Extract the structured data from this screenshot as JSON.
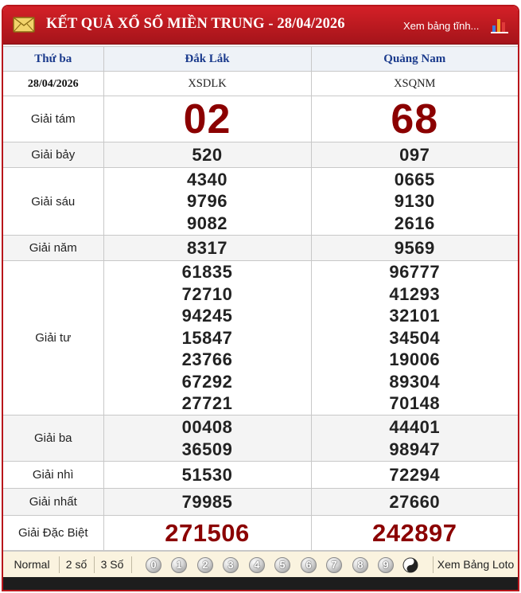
{
  "header": {
    "title": "KẾT QUẢ XỔ SỐ MIỀN TRUNG - 28/04/2026",
    "link_label": "Xem bảng tĩnh..."
  },
  "table": {
    "day": "Thứ ba",
    "date": "28/04/2026",
    "provinces": [
      {
        "name": "Đắk Lắk",
        "code": "XSDLK"
      },
      {
        "name": "Quảng Nam",
        "code": "XSQNM"
      }
    ],
    "prizes": [
      {
        "label": "Giải tám",
        "values": [
          [
            "02"
          ],
          [
            "68"
          ]
        ]
      },
      {
        "label": "Giải bảy",
        "values": [
          [
            "520"
          ],
          [
            "097"
          ]
        ]
      },
      {
        "label": "Giải sáu",
        "values": [
          [
            "4340",
            "9796",
            "9082"
          ],
          [
            "0665",
            "9130",
            "2616"
          ]
        ]
      },
      {
        "label": "Giải năm",
        "values": [
          [
            "8317"
          ],
          [
            "9569"
          ]
        ]
      },
      {
        "label": "Giải tư",
        "values": [
          [
            "61835",
            "72710",
            "94245",
            "15847",
            "23766",
            "67292",
            "27721"
          ],
          [
            "96777",
            "41293",
            "32101",
            "34504",
            "19006",
            "89304",
            "70148"
          ]
        ]
      },
      {
        "label": "Giải ba",
        "values": [
          [
            "00408",
            "36509"
          ],
          [
            "44401",
            "98947"
          ]
        ]
      },
      {
        "label": "Giải nhì",
        "values": [
          [
            "51530"
          ],
          [
            "72294"
          ]
        ]
      },
      {
        "label": "Giải nhất",
        "values": [
          [
            "79985"
          ],
          [
            "27660"
          ]
        ]
      },
      {
        "label": "Giải Đặc Biệt",
        "values": [
          [
            "271506"
          ],
          [
            "242897"
          ]
        ]
      }
    ]
  },
  "toolbar": {
    "normal": "Normal",
    "two": "2 số",
    "three": "3 Số",
    "digits": [
      "0",
      "1",
      "2",
      "3",
      "4",
      "5",
      "6",
      "7",
      "8",
      "9"
    ],
    "loto_label": "Xem Bảng Loto"
  },
  "colors": {
    "header_bg": "#b8161b",
    "prize_number": "#8b0000",
    "province_link": "#1a3a8c",
    "toolbar_bg": "#faf3df"
  },
  "icons": {
    "envelope": "envelope-icon",
    "chart": "bar-chart-icon",
    "yin_yang": "yin-yang-icon"
  }
}
